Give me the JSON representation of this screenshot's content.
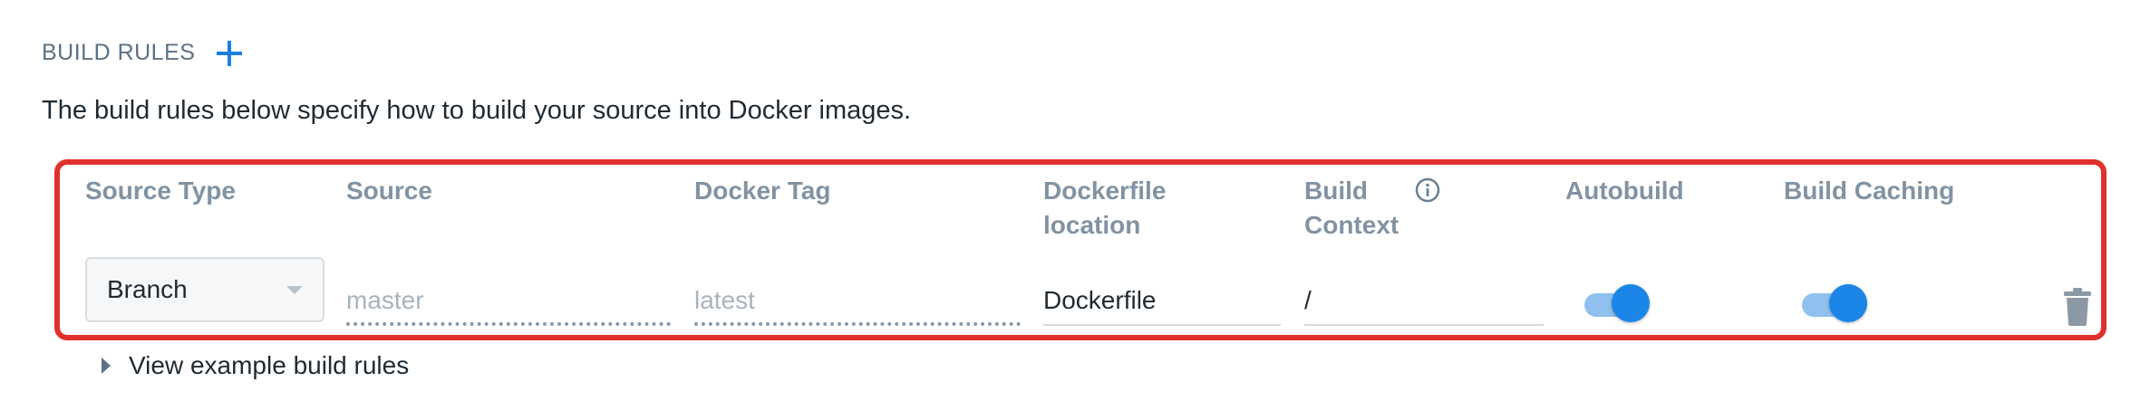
{
  "section": {
    "title": "BUILD RULES",
    "description": "The build rules below specify how to build your source into Docker images."
  },
  "columns": {
    "source_type": "Source Type",
    "source": "Source",
    "docker_tag": "Docker Tag",
    "dockerfile_location_line1": "Dockerfile",
    "dockerfile_location_line2": "location",
    "build_context_line1": "Build",
    "build_context_line2": "Context",
    "autobuild": "Autobuild",
    "build_caching": "Build Caching"
  },
  "rule": {
    "source_type": "Branch",
    "source_placeholder": "master",
    "docker_tag_placeholder": "latest",
    "dockerfile_location": "Dockerfile",
    "build_context": "/",
    "autobuild_enabled": true,
    "build_caching_enabled": true
  },
  "expander": {
    "label": "View example build rules"
  },
  "colors": {
    "accent": "#1c86e8",
    "highlight_border": "#e0302b",
    "header_text": "#8193a3"
  },
  "icons": {
    "add": "plus-icon",
    "info": "info-circle-icon",
    "delete": "trash-icon",
    "dropdown": "chevron-down-icon",
    "expand": "triangle-right-icon"
  }
}
